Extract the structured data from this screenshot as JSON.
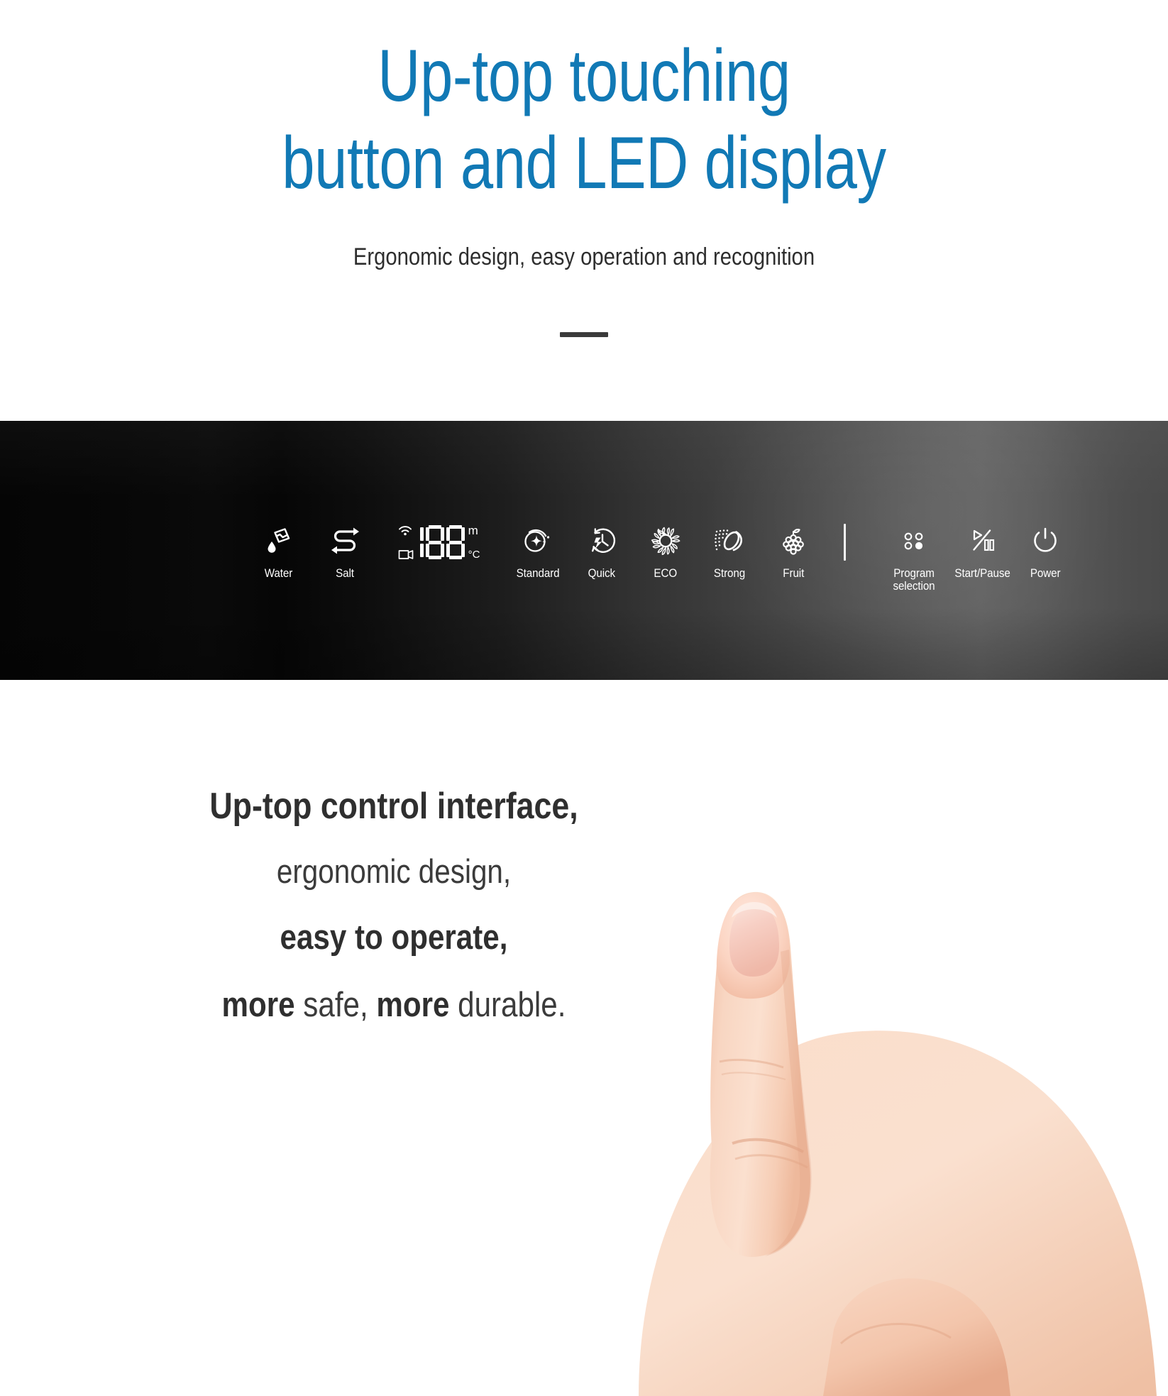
{
  "hero": {
    "headline_line1": "Up-top touching",
    "headline_line2": "button and LED display",
    "subtitle": "Ergonomic design, easy operation and recognition",
    "accent_color": "#1179b5",
    "subtitle_color": "#2e2e2e",
    "divider_color": "#3a3a3a"
  },
  "panel": {
    "background_left": "#050505",
    "background_right": "#5e5e5e",
    "led": {
      "digit_1": "1",
      "digit_2": "8",
      "digit_3": "8",
      "unit_top": "m",
      "unit_bottom": "°C",
      "indicator_top": "wifi-icon",
      "indicator_bottom": "rinse-aid-icon",
      "segment_color": "#ffffff"
    },
    "controls": [
      {
        "id": "water",
        "label": "Water",
        "icon": "water-drop-tap-icon"
      },
      {
        "id": "salt",
        "label": "Salt",
        "icon": "salt-loop-arrow-icon"
      },
      {
        "id": "standard",
        "label": "Standard",
        "icon": "sparkle-circle-icon"
      },
      {
        "id": "quick",
        "label": "Quick",
        "icon": "clock-bolt-icon"
      },
      {
        "id": "eco",
        "label": "ECO",
        "icon": "eco-sunburst-icon"
      },
      {
        "id": "strong",
        "label": "Strong",
        "icon": "strong-spray-icon"
      },
      {
        "id": "fruit",
        "label": "Fruit",
        "icon": "grapes-icon"
      },
      {
        "id": "program",
        "label": "Program selection",
        "icon": "four-dots-icon"
      },
      {
        "id": "startpause",
        "label": "Start/Pause",
        "icon": "play-pause-icon"
      },
      {
        "id": "power",
        "label": "Power",
        "icon": "power-icon"
      }
    ]
  },
  "bottom_copy": {
    "line1": "Up-top control interface,",
    "line2": "ergonomic design,",
    "line3": "easy to operate,",
    "line4_a": "more",
    "line4_b": " safe, ",
    "line4_c": "more",
    "line4_d": " durable.",
    "text_color": "#2f2f2f"
  }
}
